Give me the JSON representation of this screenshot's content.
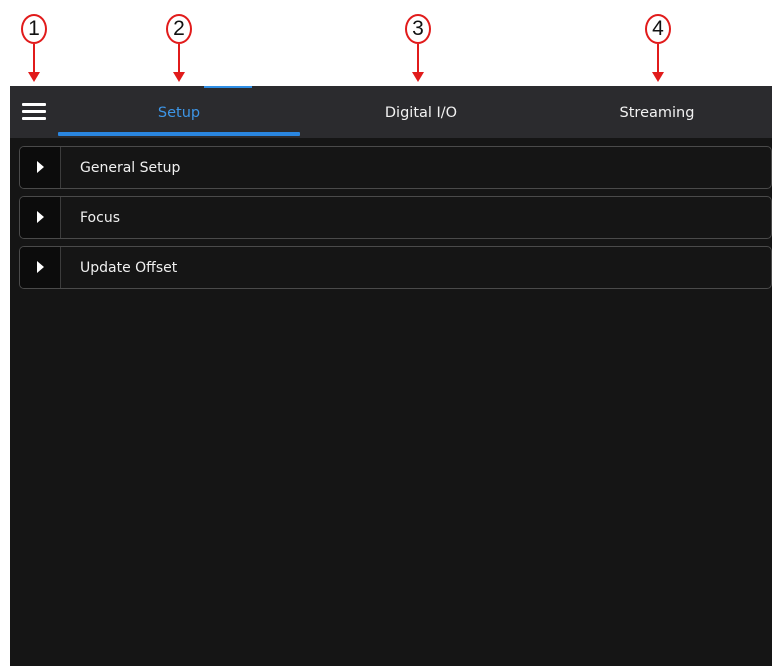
{
  "callouts": [
    "1",
    "2",
    "3",
    "4"
  ],
  "tabs": {
    "setup": "Setup",
    "digital_io": "Digital I/O",
    "streaming": "Streaming"
  },
  "sections": {
    "general_setup": "General Setup",
    "focus": "Focus",
    "update_offset": "Update Offset"
  },
  "icons": {
    "menu": "hamburger-menu-icon",
    "expand": "triangle-right-icon"
  },
  "colors": {
    "accent": "#2a86e0",
    "callout": "#e11b1b",
    "tabbar_bg": "#2b2b2e",
    "content_bg": "#151515"
  }
}
